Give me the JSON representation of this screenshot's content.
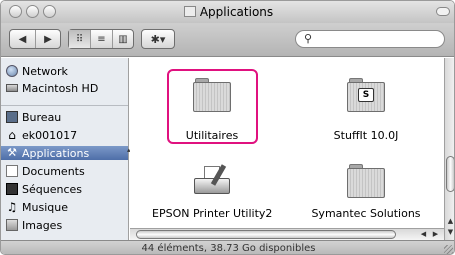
{
  "window": {
    "title": "Applications"
  },
  "toolbar": {
    "back_icon": "◀",
    "forward_icon": "▶",
    "view_icons": [
      "⠿",
      "≡",
      "▥"
    ],
    "action_icon": "✱▾",
    "search_icon": "⚲",
    "search_value": ""
  },
  "sidebar": {
    "devices": [
      {
        "label": "Network",
        "icon": "network-icon"
      },
      {
        "label": "Macintosh HD",
        "icon": "hard-drive-icon"
      }
    ],
    "places": [
      {
        "label": "Bureau",
        "icon": "desktop-icon"
      },
      {
        "label": "ek001017",
        "icon": "home-icon"
      },
      {
        "label": "Applications",
        "icon": "applications-icon",
        "selected": true
      },
      {
        "label": "Documents",
        "icon": "documents-icon"
      },
      {
        "label": "Séquences",
        "icon": "movies-icon"
      },
      {
        "label": "Musique",
        "icon": "music-icon"
      },
      {
        "label": "Images",
        "icon": "pictures-icon"
      }
    ]
  },
  "files": [
    {
      "label": "Utilitaires",
      "icon": "utilities-folder-icon",
      "highlighted": true
    },
    {
      "label": "StuffIt 10.0J",
      "icon": "stuffit-folder-icon"
    },
    {
      "label": "EPSON Printer Utility2",
      "icon": "epson-printer-utility-icon"
    },
    {
      "label": "Symantec Solutions",
      "icon": "symantec-folder-icon"
    }
  ],
  "status": {
    "text": "44 éléments, 38.73 Go disponibles"
  },
  "colors": {
    "highlight_border": "#e0117f",
    "sidebar_selection": "#4e6ea8",
    "sidebar_bg": "#e8ecf1"
  }
}
